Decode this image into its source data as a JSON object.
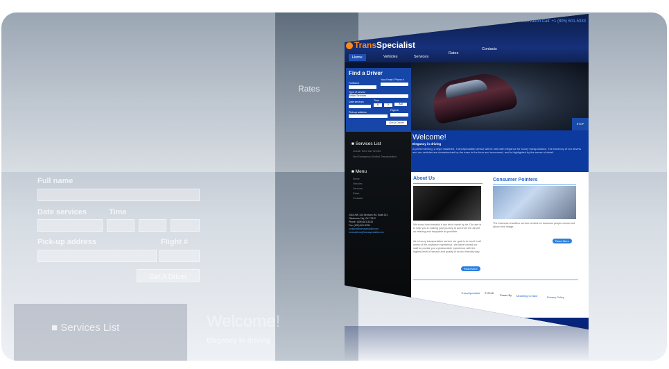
{
  "backdrop": {
    "rates": "Rates",
    "full_name": "Full name",
    "date_services": "Date services",
    "time": "Time",
    "pickup_address": "Pick-up address",
    "flight": "Flight #",
    "get_driver": "Get A Driver",
    "services_list": "Services List",
    "welcome": "Welcome!",
    "elegancy": "Elegancy in driving"
  },
  "site": {
    "reservation": "For Reservation Call: +1 (805) 601-5333",
    "logo_t": "Trans",
    "logo_rest": "Specialist",
    "nav": [
      "Home",
      "Vehicles",
      "Services",
      "Rates",
      "Contacts"
    ],
    "finder": {
      "title": "Find a Driver",
      "fullname": "FullName",
      "email": "Your Email / Phone #",
      "type": "Type of service",
      "type_value": "Sedan Services",
      "date": "Date services",
      "time": "Time",
      "hour": "8",
      "minute": "0",
      "ampm": "AM",
      "pickup": "Pick-up address",
      "flight": "Flight #",
      "button": "Get A Driver"
    },
    "stop": "STOP",
    "welcome": {
      "title": "Welcome!",
      "subtitle": "Elegancy in driving",
      "text": "A perfect driving, a style mastered. TransSpecialist service will be held with elegance for luxury transportation. The harmony of our drivers and our vehicles are characterized by the ease in the form and movement, and is highlighted by the sense of detail."
    },
    "services_list": {
      "title": "Services List",
      "items": [
        "Lincoln Town Car Service",
        "Non Emergency Medical Transportation"
      ]
    },
    "menu": {
      "title": "Menu",
      "items": [
        "Home",
        "Vehicles",
        "Services",
        "Rates",
        "Contacts"
      ]
    },
    "contact": [
      "2451 NW 144 Services Rd, Suite 201",
      "Oklahoma City, OK 73112",
      "Phone: (405) 601-5333",
      "Fax: (405) 601-5334",
      "contact@transspecialist.com",
      "reservations@transspecialist.com"
    ],
    "about": {
      "title": "About Us",
      "text1": "We know how stressful it can be to travel by air. Our aim is to help you in making your journey to and from the airport as relaxing and enjoyable as possible.",
      "text2": "As a luxury transportation service our goal is to excel in all areas of the customer experience. We have trained our staff to provide you a pleasurable experience with the highest level of service and quality in an eco friendly way.",
      "read_more": "Read More"
    },
    "consumer": {
      "title": "Consumer Pointers",
      "text": "The business chauffeur service is ideal for business people concerned about their image.",
      "read_more": "Read More"
    },
    "footer": {
      "brand": "TransSpecialist",
      "copy": "© 2016",
      "power": "Power By",
      "designer": "Modeling Creator",
      "privacy": "Privacy Policy"
    }
  }
}
